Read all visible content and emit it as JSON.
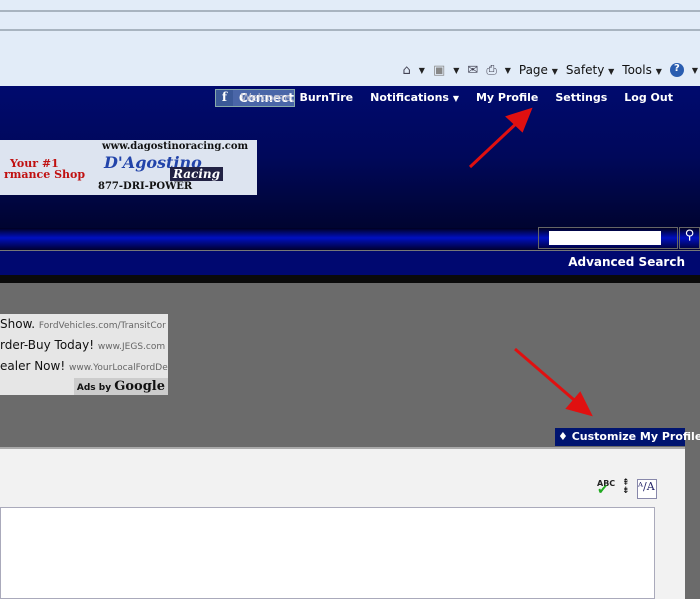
{
  "browser": {
    "commands": [
      {
        "icon": "home-icon"
      },
      {
        "icon": "rss-feed-icon"
      },
      {
        "icon": "mail-icon"
      },
      {
        "icon": "print-icon"
      }
    ],
    "menus": [
      "Page",
      "Safety",
      "Tools"
    ],
    "help_icon": "help-icon"
  },
  "header": {
    "facebook_connect": "Connect",
    "welcome": "Welcome,",
    "username": "BurnTire",
    "nav": [
      "Notifications",
      "My Profile",
      "Settings",
      "Log Out"
    ]
  },
  "banner": {
    "url": "www.dagostinoracing.com",
    "tagline1": "Your #1",
    "tagline2": "rmance Shop",
    "brand": "D'Agostino",
    "brand2": "Racing",
    "phone": "877-DRI-POWER"
  },
  "search": {
    "value": "",
    "advanced": "Advanced Search"
  },
  "ads": {
    "rows": [
      {
        "text": "Show.",
        "url": "FordVehicles.com/TransitCor"
      },
      {
        "text": "rder-Buy Today!",
        "url": "www.JEGS.com"
      },
      {
        "text": "ealer Now!",
        "url": "www.YourLocalFordDea"
      }
    ],
    "ads_by": "Ads by",
    "google": "Google"
  },
  "customize": {
    "label": "Customize My Profile"
  },
  "annotation_color": "#e01010"
}
